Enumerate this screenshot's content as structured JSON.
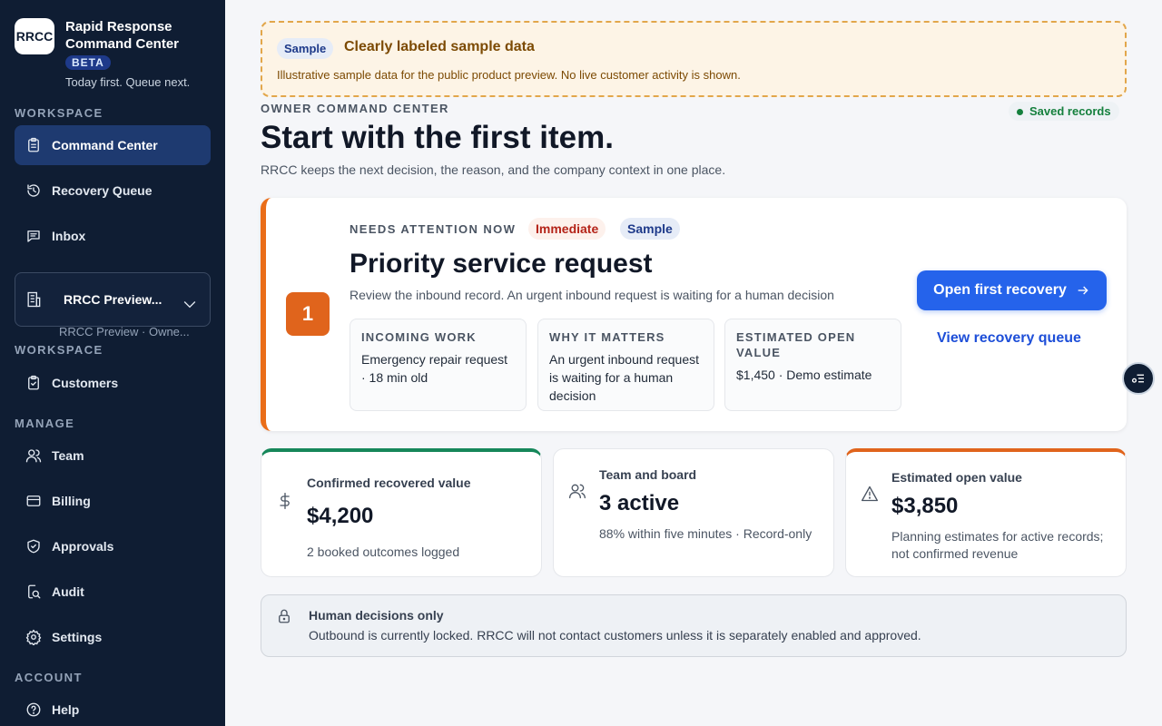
{
  "app": {
    "logo_text": "RRCC",
    "name": "Rapid Response Command Center",
    "badge": "BETA",
    "tagline": "Today first. Queue next."
  },
  "sidebar": {
    "section_workspace": "WORKSPACE",
    "nav_primary": [
      {
        "label": "Command Center",
        "icon": "clipboard-icon",
        "active": true
      },
      {
        "label": "Recovery Queue",
        "icon": "history-icon"
      },
      {
        "label": "Inbox",
        "icon": "message-icon"
      }
    ],
    "workspace_select": {
      "name": "RRCC Preview...",
      "subtitle": "RRCC Preview · Owne..."
    },
    "section_workspace_2": "WORKSPACE",
    "customers": "Customers",
    "section_manage": "MANAGE",
    "manage_items": [
      {
        "label": "Team",
        "icon": "users-icon"
      },
      {
        "label": "Billing",
        "icon": "credit-card-icon"
      },
      {
        "label": "Approvals",
        "icon": "shield-check-icon"
      },
      {
        "label": "Audit",
        "icon": "audit-icon"
      },
      {
        "label": "Settings",
        "icon": "gear-icon"
      }
    ],
    "section_account": "ACCOUNT",
    "help": "Help"
  },
  "banner": {
    "pill": "Sample",
    "title": "Clearly labeled sample data",
    "text": "Illustrative sample data for the public product preview. No live customer activity is shown."
  },
  "header": {
    "overline": "OWNER COMMAND CENTER",
    "saved": "Saved records",
    "title": "Start with the first item.",
    "subtitle": "RRCC keeps the next decision, the reason, and the company context in one place."
  },
  "priority": {
    "number": "1",
    "overline": "NEEDS ATTENTION NOW",
    "pill_urgency": "Immediate",
    "pill_sample": "Sample",
    "title": "Priority service request",
    "description": "Review the inbound record. An urgent inbound request is waiting for a human decision",
    "cards": [
      {
        "label": "INCOMING WORK",
        "value": "Emergency repair request · 18 min old"
      },
      {
        "label": "WHY IT MATTERS",
        "value": "An urgent inbound request is waiting for a human decision"
      },
      {
        "label": "ESTIMATED OPEN VALUE",
        "value": "$1,450 · Demo estimate"
      }
    ],
    "primary_button": "Open first recovery",
    "secondary_link": "View recovery queue"
  },
  "stats": [
    {
      "label": "Confirmed recovered value",
      "value": "$4,200",
      "sub": "2 booked outcomes logged",
      "accent": "#16875a"
    },
    {
      "label": "Team and board",
      "value": "3 active",
      "sub": "88% within five minutes · Record-only"
    },
    {
      "label": "Estimated open value",
      "value": "$3,850",
      "sub": "Planning estimates for active records; not confirmed revenue",
      "accent": "#e0641c"
    }
  ],
  "notice": {
    "title": "Human decisions only",
    "text": "Outbound is currently locked. RRCC will not contact customers unless it is separately enabled and approved."
  },
  "colors": {
    "sidebar_bg": "#0f1d33",
    "primary": "#2563eb",
    "priority_accent": "#ea6d18",
    "success": "#15803d"
  }
}
